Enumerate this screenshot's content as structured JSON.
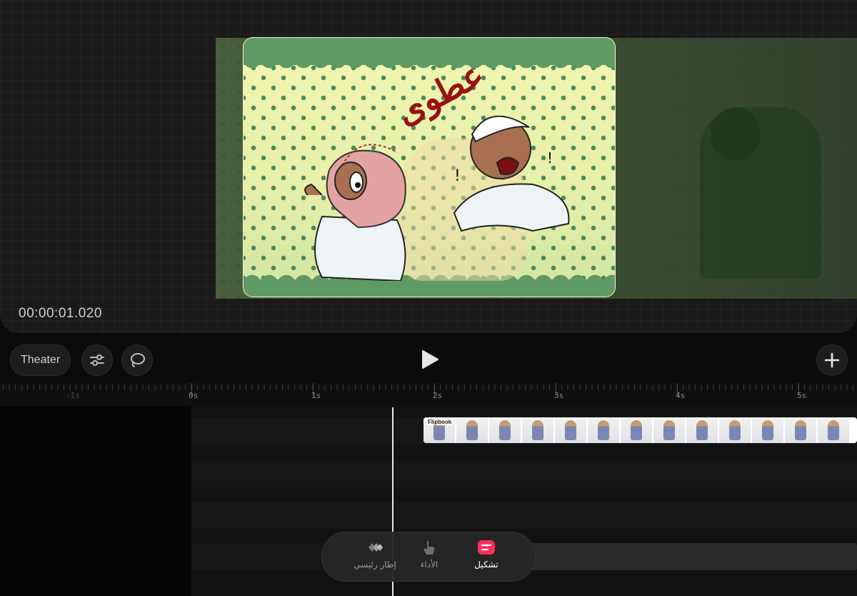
{
  "preview": {
    "timecode": "00:00:01.020",
    "artwork_text": "عطوى"
  },
  "toolbar": {
    "theater_label": "Theater",
    "settings_icon": "sliders-icon",
    "lasso_icon": "lasso-icon",
    "play_icon": "play-icon",
    "add_icon": "plus-icon"
  },
  "ruler": {
    "labels": [
      "-1s",
      "0s",
      "1s",
      "2s",
      "3s",
      "4s",
      "5s"
    ]
  },
  "timeline": {
    "clip_label": "Flipbook"
  },
  "tabbar": {
    "tabs": [
      {
        "label": "إطار رئيسي",
        "icon": "keyframe-icon",
        "active": false
      },
      {
        "label": "الأداء",
        "icon": "hand-pointer-icon",
        "active": false
      },
      {
        "label": "تشكيل",
        "icon": "shape-icon",
        "active": true
      }
    ]
  },
  "colors": {
    "accent": "#ff2d5a",
    "frame_green": "#5f9a64",
    "frame_yellow": "#eef2a6"
  }
}
